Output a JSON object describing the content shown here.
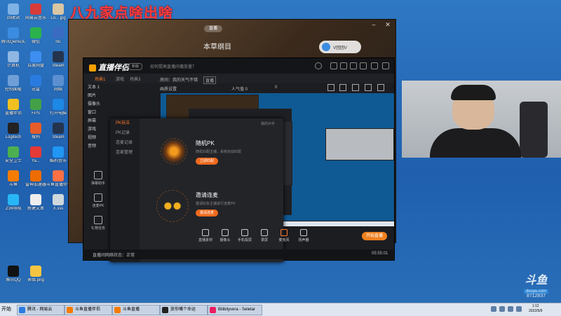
{
  "banner": "八九家点啥出啥",
  "desktop_icons": [
    {
      "label": "回收站",
      "color": "#7fb2e5"
    },
    {
      "label": "网易云音乐",
      "color": "#d83b3b"
    },
    {
      "label": "Lo... jpg",
      "color": "#d9c6a2"
    },
    {
      "label": "腾讯Qemu实用",
      "color": "#3a8ce0"
    },
    {
      "label": "微信",
      "color": "#2bb24c"
    },
    {
      "label": "SE",
      "color": "#3a6bc2"
    },
    {
      "label": "计算机",
      "color": "#8fb7e2"
    },
    {
      "label": "百度网盘",
      "color": "#3d8ef0"
    },
    {
      "label": "Steam",
      "color": "#24344d"
    },
    {
      "label": "控制面板",
      "color": "#6f9ed6"
    },
    {
      "label": "迅雷",
      "color": "#2a7be0"
    },
    {
      "label": "网络",
      "color": "#5b8fd0"
    },
    {
      "label": "直播伴侣",
      "color": "#f0c020"
    },
    {
      "label": "FPS",
      "color": "#43a047"
    },
    {
      "label": "打开电脑",
      "color": "#1e88e5"
    },
    {
      "label": "Logitech",
      "color": "#222222"
    },
    {
      "label": "搜狗",
      "color": "#e65c2a"
    },
    {
      "label": "Steam",
      "color": "#24344d"
    },
    {
      "label": "安全卫士",
      "color": "#4caf50"
    },
    {
      "label": "Ya...",
      "color": "#e53935"
    },
    {
      "label": "酷狗音乐",
      "color": "#2196f3"
    },
    {
      "label": "斗鱼",
      "color": "#f57c00"
    },
    {
      "label": "雷神加速器",
      "color": "#ef6c00"
    },
    {
      "label": "斗鱼直播伴侣",
      "color": "#ff7043"
    },
    {
      "label": "上网导航",
      "color": "#29b6f6"
    },
    {
      "label": "新建文本",
      "color": "#eeeeee"
    },
    {
      "label": "X.sss",
      "color": "#cfd8dc"
    },
    {
      "label": "腾讯QQ",
      "color": "#111111"
    },
    {
      "label": "表情.png",
      "color": "#f5c542"
    }
  ],
  "video_window": {
    "tag": "直播",
    "title": "本草纲目",
    "music_chip": "V团团V"
  },
  "companion": {
    "logo": "直播伴侣",
    "version": "新版",
    "notice": "如何提高直播间播放量？",
    "toolbar_tabs": [
      "场景1",
      "游戏",
      "场景3"
    ],
    "room_label": "房间：我的天气不错",
    "room_tag": "直播",
    "quality": "画质设置",
    "viewers": "人气值 0",
    "fans": "0",
    "scene_list": [
      "文本 1",
      "图片",
      "摄像头",
      "窗口",
      "屏幕",
      "游戏",
      "视频",
      "音频"
    ],
    "pk_tabs": [
      "PK玩法",
      "PK记录",
      "连麦记录",
      "连麦管理"
    ],
    "pk_header_right": "我的对手",
    "pk_random_title": "随机PK",
    "pk_random_desc": "随机匹配主播，系统自动匹配",
    "pk_random_btn": "立即匹配",
    "pk_invite_title": "邀请连麦",
    "pk_invite_desc": "邀请好友主播进行连麦PK",
    "pk_invite_btn": "邀请连麦",
    "left_nav": [
      "弹幕助手",
      "连麦PK",
      "礼物任务"
    ],
    "bottom_tools": [
      "直播素材",
      "摄像头",
      "手机投屏",
      "录屏",
      "麦克风",
      "扬声器"
    ],
    "start_live": "开始直播",
    "status_text": "直播间网络状态：正常",
    "timer": "05:55:01"
  },
  "watermark": {
    "logo": "斗鱼",
    "sub": "douyu.com",
    "number": "8712837"
  },
  "taskbar": {
    "start": "开始",
    "tasks": [
      {
        "label": "腾讯 - 网易云",
        "color": "#2b7be0"
      },
      {
        "label": "斗鱼直播伴侣",
        "color": "#f57c00"
      },
      {
        "label": "斗鱼直播",
        "color": "#f57c00"
      },
      {
        "label": "放你嘴个命运",
        "color": "#222222"
      },
      {
        "label": "Bilibilyvera - Seletar",
        "color": "#e91e63"
      }
    ],
    "clock_time": "1:12",
    "clock_date": "2022/5/9"
  }
}
